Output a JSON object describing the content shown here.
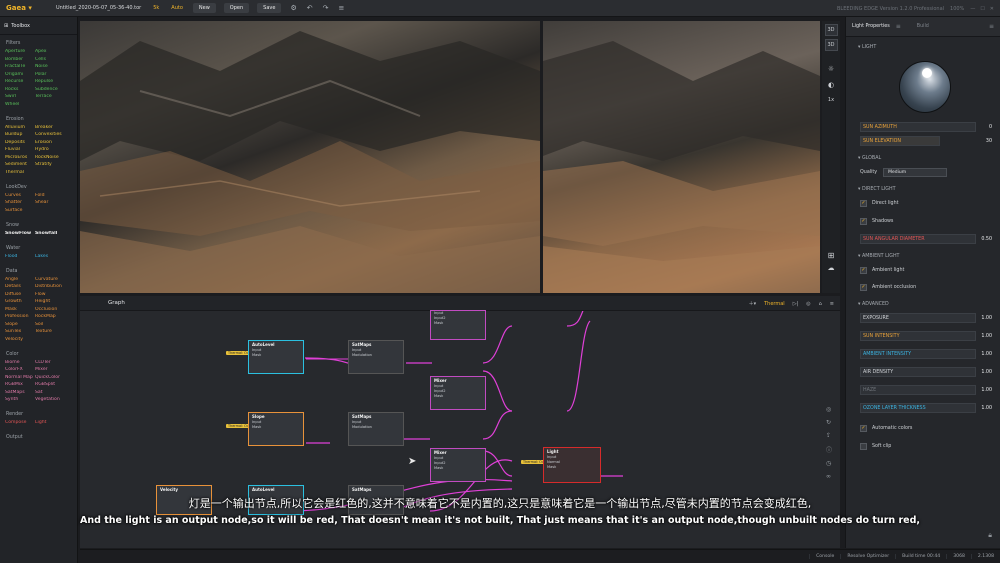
{
  "topbar": {
    "app_name": "Gaea",
    "file_name": "Untitled_2020-05-07_05-36-40.tor",
    "resolution": "5k",
    "mode": "Auto",
    "new_label": "New",
    "open_label": "Open",
    "save_label": "Save",
    "version": "BLEEDING EDGE Version 1.2.0 Professional",
    "zoom": "100%"
  },
  "toolbox": {
    "title": "Toolbox",
    "sections": [
      {
        "title": "Filters",
        "items": [
          [
            "Aperture",
            "Apex"
          ],
          [
            "Bomber",
            "Cells"
          ],
          [
            "FractalTe",
            "Noise"
          ],
          [
            "Origami",
            "Polar"
          ],
          [
            "Recurse",
            "Repulse"
          ],
          [
            "Rocks",
            "Subdence"
          ],
          [
            "Swirl",
            "Terrace"
          ],
          [
            "Wheel",
            ""
          ]
        ]
      },
      {
        "title": "Erosion",
        "items": [
          [
            "Alluvium",
            "Breaker"
          ],
          [
            "Buildup",
            "Convexities"
          ],
          [
            "Deposits",
            "Erosion"
          ],
          [
            "Fluvial",
            "Hydro"
          ],
          [
            "MicroEros",
            "RockNoise"
          ],
          [
            "Sediment",
            "Stratify"
          ],
          [
            "Thermal",
            ""
          ]
        ]
      },
      {
        "title": "LookDev",
        "items": [
          [
            "Curves",
            "Fold"
          ],
          [
            "Shatter",
            "Shear"
          ],
          [
            "Surface",
            ""
          ]
        ]
      },
      {
        "title": "Snow",
        "items": [
          [
            "SnowFlow",
            "Snowfall"
          ]
        ]
      },
      {
        "title": "Water",
        "items": [
          [
            "Flood",
            "Lakes"
          ]
        ]
      },
      {
        "title": "Data",
        "items": [
          [
            "Angle",
            "Curvature"
          ],
          [
            "Details",
            "Distribution"
          ],
          [
            "Diffuse",
            "Flow"
          ],
          [
            "Growth",
            "Height"
          ],
          [
            "Mask",
            "Occlusion"
          ],
          [
            "Profession",
            "RockMap"
          ],
          [
            "Slope",
            "Soil"
          ],
          [
            "SunTex",
            "Texture"
          ],
          [
            "Velocity",
            ""
          ]
        ]
      },
      {
        "title": "Color",
        "items": [
          [
            "Biome",
            "CLUTer"
          ],
          [
            "ColorFX",
            "Mixer"
          ],
          [
            "Normal Map",
            "QuickColor"
          ],
          [
            "RGBMix",
            "RGBSplit"
          ],
          [
            "SatMaps",
            "Sat"
          ],
          [
            "Synth",
            "Vegetation"
          ]
        ]
      },
      {
        "title": "Render",
        "items": [
          [
            "Compose",
            "Light"
          ]
        ]
      },
      {
        "title": "Output",
        "items": []
      }
    ]
  },
  "viewport_side": {
    "btn_3d_a": "3D",
    "btn_3d_b": "3D",
    "zoom": "1x"
  },
  "graph": {
    "title": "Graph",
    "tools_label": "Thermal",
    "nodes": [
      {
        "title": "AutoLevel",
        "ports": [
          "Input",
          "Mask",
          "Output"
        ]
      },
      {
        "title": "SatMaps",
        "ports": [
          "Input",
          "Modulation",
          "Output"
        ]
      },
      {
        "title": "Slope",
        "ports": [
          "Input",
          "Mask",
          "Output"
        ]
      },
      {
        "title": "SatMaps",
        "ports": [
          "Input",
          "Modulation",
          "Output"
        ]
      },
      {
        "title": "Mixer",
        "ports": [
          "Input",
          "Input2",
          "Mask"
        ]
      },
      {
        "title": "Mixer",
        "ports": [
          "Input",
          "Input2",
          "Input3",
          "Mask"
        ]
      },
      {
        "title": "Light",
        "ports": [
          "Input",
          "Normal",
          "Mask"
        ]
      },
      {
        "title": "Velocity",
        "ports": []
      },
      {
        "title": "AutoLevel",
        "ports": []
      },
      {
        "title": "SatMaps",
        "ports": []
      }
    ],
    "tag_label": "Thermal: Ou..."
  },
  "light_panel": {
    "tab_active": "Light Properties",
    "tab_inactive": "Build",
    "section_light": "LIGHT",
    "sun_azimuth_label": "SUN AZIMUTH",
    "sun_azimuth": "0",
    "sun_elevation_label": "SUN ELEVATION",
    "sun_elevation": "30",
    "section_global": "GLOBAL",
    "quality_label": "Quality",
    "quality_value": "Medium",
    "section_direct": "DIRECT LIGHT",
    "direct_light_label": "Direct light",
    "shadows_label": "Shadows",
    "sun_angular_label": "SUN ANGULAR DIAMETER",
    "sun_angular": "0.50",
    "section_ambient": "AMBIENT LIGHT",
    "ambient_light_label": "Ambient light",
    "ambient_occlusion_label": "Ambient occlusion",
    "section_advanced": "ADVANCED",
    "exposure_label": "EXPOSURE",
    "exposure": "1.00",
    "sun_intensity_label": "SUN INTENSITY",
    "sun_intensity": "1.00",
    "ambient_intensity_label": "AMBIENT INTENSITY",
    "ambient_intensity": "1.00",
    "air_density_label": "AIR DENSITY",
    "air_density": "1.00",
    "haze_label": "HAZE",
    "haze": "1.00",
    "ozone_label": "OZONE LAYER THICKNESS",
    "ozone": "1.00",
    "auto_colors_label": "Automatic colors",
    "soft_clip_label": "Soft clip"
  },
  "subtitles": {
    "zh": "灯是一个输出节点,所以它会是红色的,这并不意味着它不是内置的,这只是意味着它是一个输出节点,尽管未内置的节点会变成红色,",
    "en": "And the light is an output node,so it will be red, That doesn't mean it's not built, That just means that it's an output node,though unbuilt nodes do turn red,"
  },
  "status": {
    "console": "Console",
    "resolve": "Resolve Optimizer",
    "build_time": "Build time 00:44",
    "build_res": "3068",
    "scale": "2.1308"
  },
  "colors": {
    "accent": "#f0b429",
    "output_node": "#d62b2b",
    "wire": "#e040d8",
    "wire_cyan": "#2bc0e0"
  }
}
